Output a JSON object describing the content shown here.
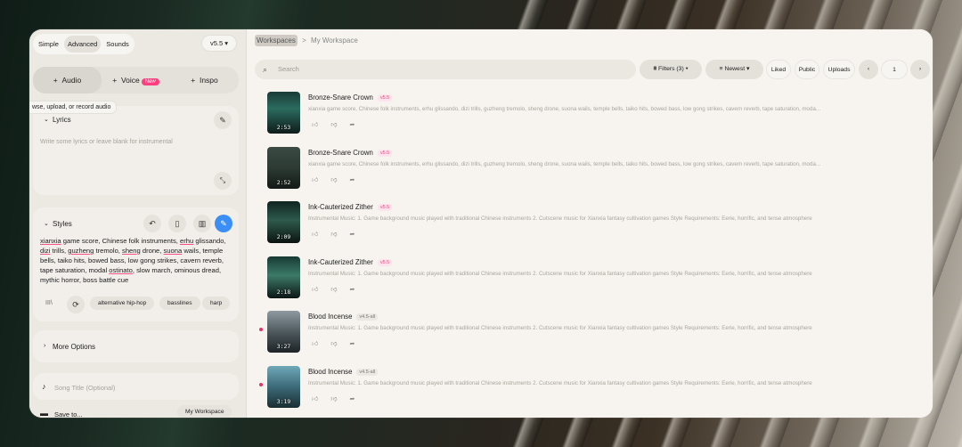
{
  "mode_tabs": [
    "Simple",
    "Advanced",
    "Sounds"
  ],
  "version": "v5.5",
  "create_tabs": {
    "audio": "Audio",
    "voice": "Voice",
    "voice_badge": "New",
    "inspo": "Inspo"
  },
  "tooltip": "wse, upload, or record audio",
  "lyrics": {
    "label": "Lyrics",
    "placeholder": "Write some lyrics or leave blank for instrumental"
  },
  "styles": {
    "label": "Styles",
    "chips": [
      "alternative hip-hop",
      "basslines",
      "harp"
    ]
  },
  "more_options": "More Options",
  "song_title_placeholder": "Song Title (Optional)",
  "save_to": {
    "label": "Save to...",
    "value": "My Workspace"
  },
  "breadcrumb": {
    "root": "Workspaces",
    "sep": ">",
    "current": "My Workspace"
  },
  "search_placeholder": "Search",
  "filters": {
    "filters": "Filters (3)",
    "sort": "Newest",
    "liked": "Liked",
    "public": "Public",
    "uploads": "Uploads",
    "page": "1"
  },
  "songs": [
    {
      "title": "Bronze-Snare Crown",
      "version": "v5.5",
      "duration": "2:53",
      "desc": "xianxia game score, Chinese folk instruments, erhu glissando, dizi trills, guzheng tremolo, sheng drone, suona wails, temple bells, taiko hits, bowed bass, low gong strikes, cavern reverb, tape saturation, moda..."
    },
    {
      "title": "Bronze-Snare Crown",
      "version": "v5.5",
      "duration": "2:52",
      "desc": "xianxia game score, Chinese folk instruments, erhu glissando, dizi trills, guzheng tremolo, sheng drone, suona wails, temple bells, taiko hits, bowed bass, low gong strikes, cavern reverb, tape saturation, moda..."
    },
    {
      "title": "Ink-Cauterized Zither",
      "version": "v5.5",
      "duration": "2:09",
      "desc": "Instrumental Music: 1. Game background music played with traditional Chinese instruments 2. Cutscene music for Xianxia fantasy cultivation games Style Requirements: Eerie, horrific, and tense atmosphere"
    },
    {
      "title": "Ink-Cauterized Zither",
      "version": "v5.5",
      "duration": "2:18",
      "desc": "Instrumental Music: 1. Game background music played with traditional Chinese instruments 2. Cutscene music for Xianxia fantasy cultivation games Style Requirements: Eerie, horrific, and tense atmosphere"
    },
    {
      "title": "Blood Incense",
      "version": "v4.5-all",
      "duration": "3:27",
      "desc": "Instrumental Music: 1. Game background music played with traditional Chinese instruments 2. Cutscene music for Xianxia fantasy cultivation games Style Requirements: Eerie, horrific, and tense atmosphere"
    },
    {
      "title": "Blood Incense",
      "version": "v4.5-all",
      "duration": "3:19",
      "desc": "Instrumental Music: 1. Game background music played with traditional Chinese instruments 2. Cutscene music for Xianxia fantasy cultivation games Style Requirements: Eerie, horrific, and tense atmosphere"
    }
  ]
}
